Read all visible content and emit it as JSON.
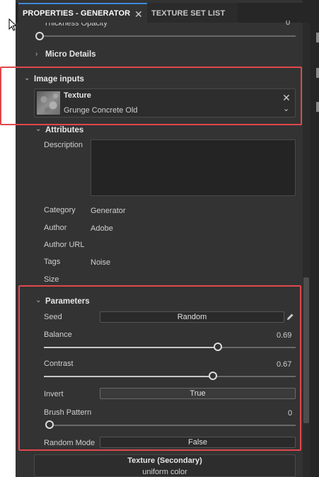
{
  "tabs": {
    "active": "PROPERTIES - GENERATOR",
    "inactive": "TEXTURE SET LIST"
  },
  "top": {
    "thickness_label": "Thickness Opacity",
    "thickness_value": "0",
    "thickness_fraction": 0.0,
    "micro_details_title": "Micro Details"
  },
  "image_inputs": {
    "title": "Image inputs",
    "texture_label": "Texture",
    "texture_value": "Grunge Concrete Old"
  },
  "attributes": {
    "title": "Attributes",
    "description_label": "Description",
    "description_value": "",
    "category_label": "Category",
    "category_value": "Generator",
    "author_label": "Author",
    "author_value": "Adobe",
    "author_url_label": "Author URL",
    "author_url_value": "",
    "tags_label": "Tags",
    "tags_value": "Noise",
    "size_label": "Size",
    "size_value": ""
  },
  "parameters": {
    "title": "Parameters",
    "seed_label": "Seed",
    "seed_button": "Random",
    "balance_label": "Balance",
    "balance_value": "0.69",
    "balance_fraction": 0.69,
    "contrast_label": "Contrast",
    "contrast_value": "0.67",
    "contrast_fraction": 0.67,
    "invert_label": "Invert",
    "invert_value": "True",
    "brush_pattern_label": "Brush Pattern",
    "brush_pattern_value": "0",
    "brush_pattern_fraction": 0.0,
    "random_mode_label": "Random Mode",
    "random_mode_value": "False"
  },
  "secondary": {
    "title": "Texture (Secondary)",
    "subtitle": "uniform color"
  },
  "colors": {
    "highlight": "#e0474c",
    "tab_accent": "#3b8ad9",
    "panel_bg": "#333333"
  }
}
